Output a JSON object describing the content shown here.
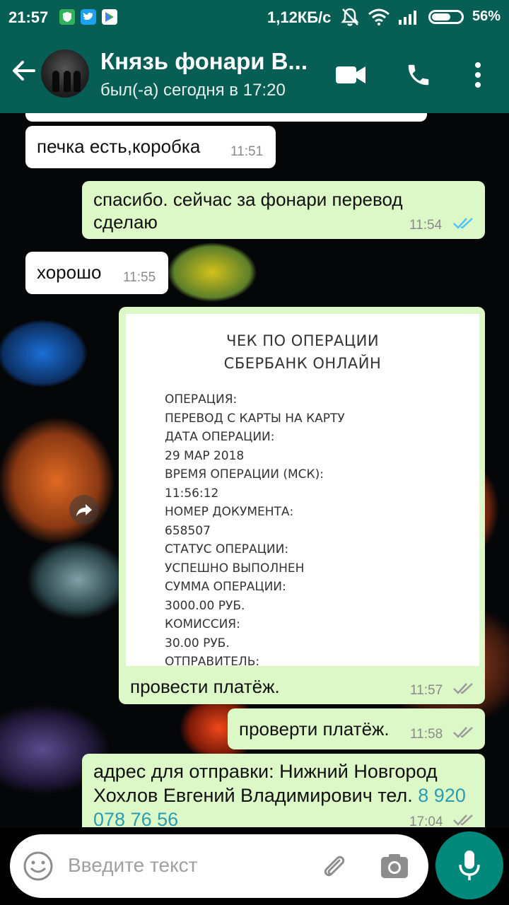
{
  "status_bar": {
    "time": "21:57",
    "network_speed": "1,12КБ/с",
    "battery": "56%",
    "battery_level": 0.56,
    "notification_icons": [
      "shield-icon",
      "twitter-icon",
      "play-store-icon"
    ]
  },
  "header": {
    "contact_name": "Князь фонари В...",
    "last_seen": "был(-а) сегодня в 17:20"
  },
  "messages": [
    {
      "direction": "in",
      "text": "печка есть,коробка",
      "time": "11:51"
    },
    {
      "direction": "out",
      "text": "спасибо. сейчас за фонари перевод сделаю",
      "time": "11:54",
      "status": "read"
    },
    {
      "direction": "in",
      "text": "хорошо",
      "time": "11:55"
    },
    {
      "direction": "out",
      "type": "image",
      "caption": "провести платёж.",
      "time": "11:57",
      "status": "delivered"
    },
    {
      "direction": "out",
      "text": "проверти платёж.",
      "time": "11:58",
      "status": "delivered"
    },
    {
      "direction": "out",
      "text": "адрес для отправки: Нижний Новгород Хохлов Евгений Владимирович тел.",
      "phone": "8 920 078 76 56",
      "time": "17:04",
      "status": "delivered"
    }
  ],
  "receipt": {
    "title_line1": "ЧЕК ПО ОПЕРАЦИИ",
    "title_line2": "СБЕРБАНК ОНЛАЙН",
    "lines": [
      "ОПЕРАЦИЯ:",
      "ПЕРЕВОД С КАРТЫ НА КАРТУ",
      "ДАТА ОПЕРАЦИИ:",
      "29 МАР 2018",
      "ВРЕМЯ ОПЕРАЦИИ (МСК):",
      "11:56:12",
      "НОМЕР ДОКУМЕНТА:",
      "658507",
      "СТАТУС ОПЕРАЦИИ:",
      "УСПЕШНО ВЫПОЛНЕН",
      "СУММА ОПЕРАЦИИ:",
      "3000.00 РУБ.",
      "КОМИССИЯ:",
      "30.00 РУБ.",
      "ОТПРАВИТЕЛЬ:"
    ]
  },
  "input": {
    "placeholder": "Введите текст"
  },
  "colors": {
    "app_bar": "#075e54",
    "outgoing_bubble": "#dcf8c6",
    "incoming_bubble": "#ffffff",
    "read_ticks": "#4fc3f7",
    "mic_button": "#00897b",
    "link": "#2a9db5"
  }
}
